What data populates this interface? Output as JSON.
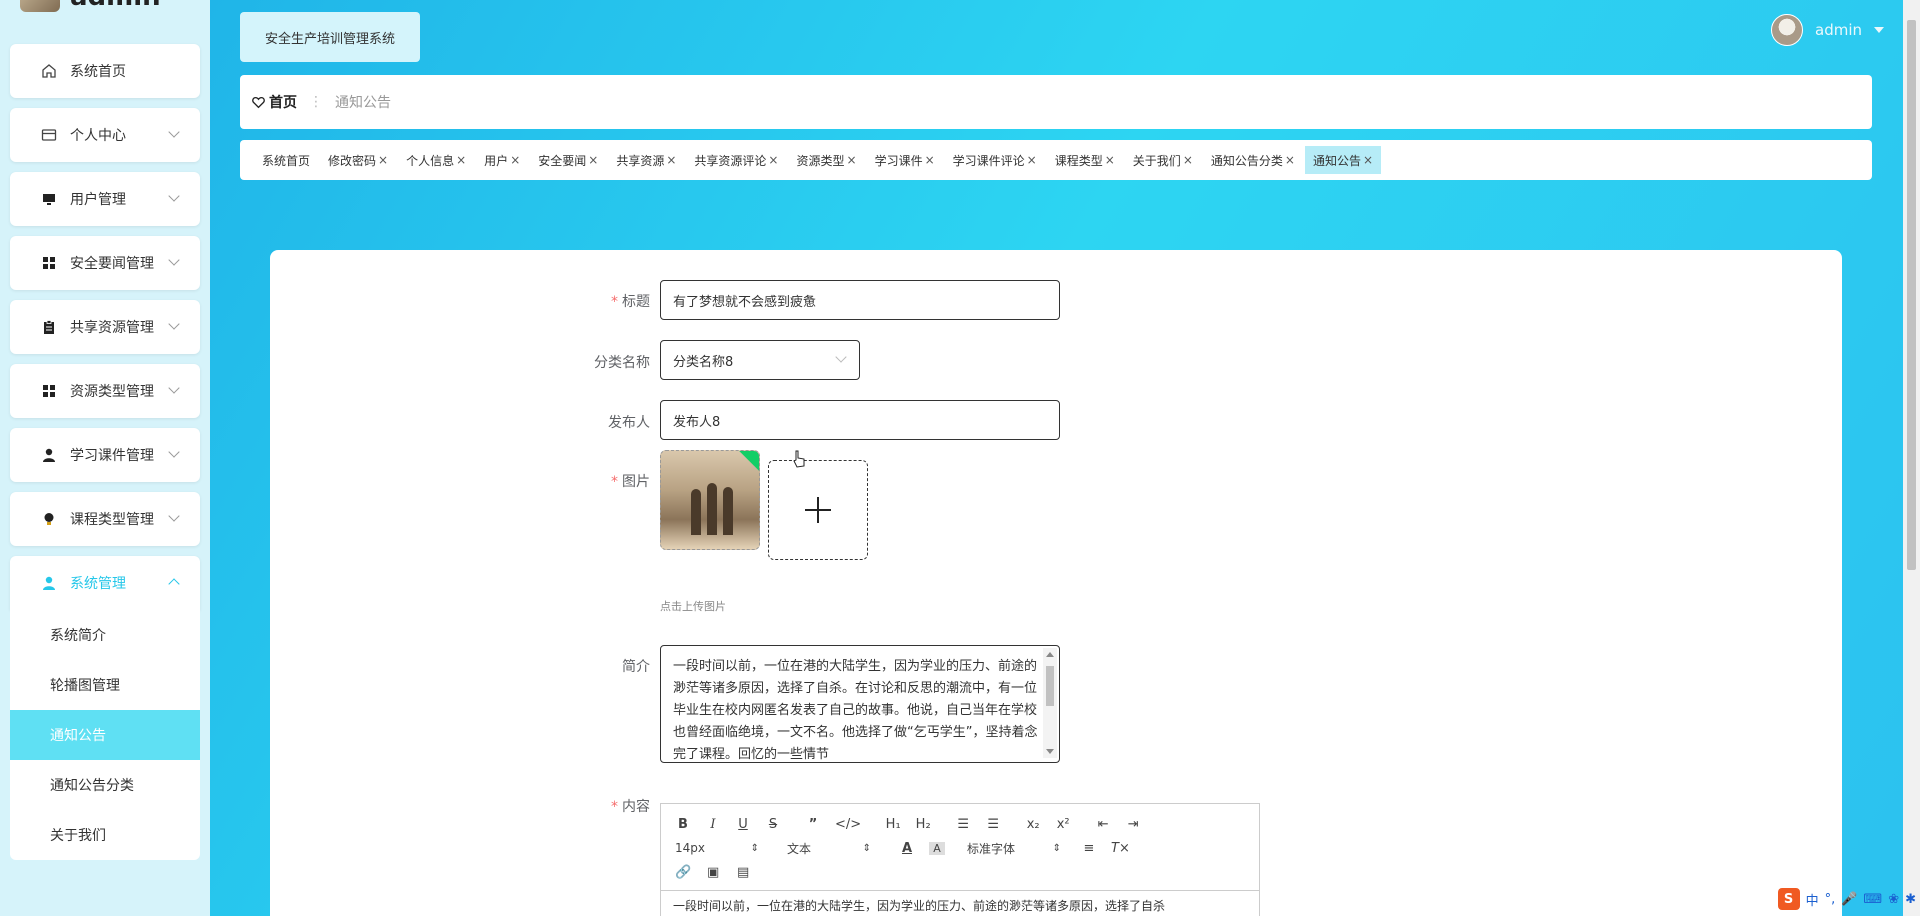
{
  "brand": {
    "title": "admin"
  },
  "sidebar": {
    "items": [
      {
        "label": "系统首页",
        "icon": "home-icon"
      },
      {
        "label": "个人中心",
        "icon": "card-icon"
      },
      {
        "label": "用户管理",
        "icon": "monitor-icon"
      },
      {
        "label": "安全要闻管理",
        "icon": "grid-icon"
      },
      {
        "label": "共享资源管理",
        "icon": "clipboard-icon"
      },
      {
        "label": "资源类型管理",
        "icon": "grid-icon"
      },
      {
        "label": "学习课件管理",
        "icon": "user-icon"
      },
      {
        "label": "课程类型管理",
        "icon": "bulb-icon"
      },
      {
        "label": "系统管理",
        "icon": "user-cog-icon"
      }
    ],
    "submenu": [
      "系统简介",
      "轮播图管理",
      "通知公告",
      "通知公告分类",
      "关于我们"
    ]
  },
  "header": {
    "system_title": "安全生产培训管理系统",
    "username": "admin"
  },
  "breadcrumb": {
    "home": "首页",
    "current": "通知公告"
  },
  "tags": [
    {
      "label": "系统首页",
      "closable": false
    },
    {
      "label": "修改密码",
      "closable": true
    },
    {
      "label": "个人信息",
      "closable": true
    },
    {
      "label": "用户",
      "closable": true
    },
    {
      "label": "安全要闻",
      "closable": true
    },
    {
      "label": "共享资源",
      "closable": true
    },
    {
      "label": "共享资源评论",
      "closable": true
    },
    {
      "label": "资源类型",
      "closable": true
    },
    {
      "label": "学习课件",
      "closable": true
    },
    {
      "label": "学习课件评论",
      "closable": true
    },
    {
      "label": "课程类型",
      "closable": true
    },
    {
      "label": "关于我们",
      "closable": true
    },
    {
      "label": "通知公告分类",
      "closable": true
    },
    {
      "label": "通知公告",
      "closable": true
    }
  ],
  "form": {
    "title_label": "标题",
    "title_value": "有了梦想就不会感到疲惫",
    "category_label": "分类名称",
    "category_value": "分类名称8",
    "publisher_label": "发布人",
    "publisher_value": "发布人8",
    "image_label": "图片",
    "image_hint": "点击上传图片",
    "intro_label": "简介",
    "intro_value": "一段时间以前，一位在港的大陆学生，因为学业的压力、前途的渺茫等诸多原因，选择了自杀。在讨论和反思的潮流中，有一位毕业生在校内网匿名发表了自己的故事。他说，自己当年在学校也曾经面临绝境，一文不名。他选择了做“乞丐学生”，坚持着念完了课程。回忆的一些情节",
    "content_label": "内容"
  },
  "editor": {
    "font_size": "14px",
    "block_type": "文本",
    "font_family": "标准字体",
    "body_preview": "一段时间以前，一位在港的大陆学生，因为学业的压力、前途的渺茫等诸多原因，选择了自杀"
  },
  "ime": {
    "lang": "中"
  }
}
